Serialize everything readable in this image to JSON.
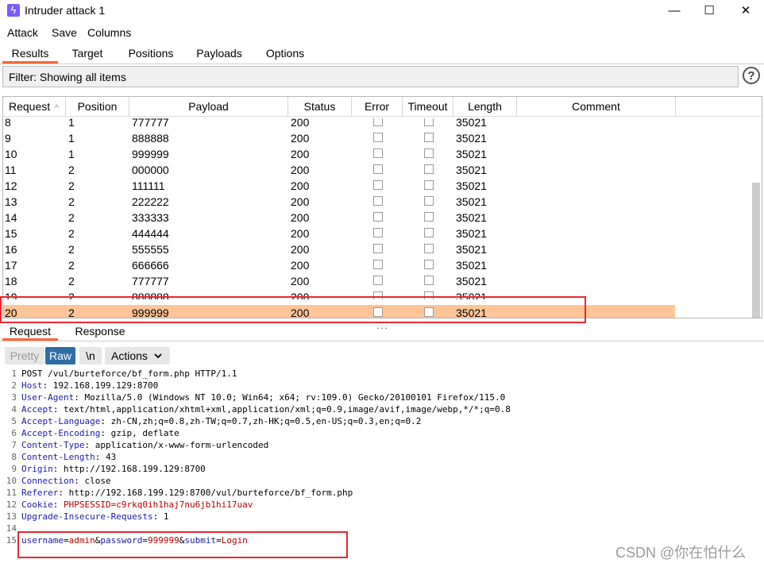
{
  "window": {
    "title": "Intruder attack 1",
    "minimize": "—",
    "maximize": "☐",
    "close": "✕"
  },
  "menu": [
    "Attack",
    "Save",
    "Columns"
  ],
  "tabs": [
    "Results",
    "Target",
    "Positions",
    "Payloads",
    "Options"
  ],
  "filter": {
    "text": "Filter: Showing all items",
    "help": "?"
  },
  "table": {
    "columns": [
      "Request",
      "Position",
      "Payload",
      "Status",
      "Error",
      "Timeout",
      "Length",
      "Comment"
    ],
    "sort_indicator": "^",
    "rows": [
      {
        "request": "8",
        "position": "1",
        "payload": "777777",
        "status": "200",
        "length": "35021"
      },
      {
        "request": "9",
        "position": "1",
        "payload": "888888",
        "status": "200",
        "length": "35021"
      },
      {
        "request": "10",
        "position": "1",
        "payload": "999999",
        "status": "200",
        "length": "35021"
      },
      {
        "request": "11",
        "position": "2",
        "payload": "000000",
        "status": "200",
        "length": "35021"
      },
      {
        "request": "12",
        "position": "2",
        "payload": "111111",
        "status": "200",
        "length": "35021"
      },
      {
        "request": "13",
        "position": "2",
        "payload": "222222",
        "status": "200",
        "length": "35021"
      },
      {
        "request": "14",
        "position": "2",
        "payload": "333333",
        "status": "200",
        "length": "35021"
      },
      {
        "request": "15",
        "position": "2",
        "payload": "444444",
        "status": "200",
        "length": "35021"
      },
      {
        "request": "16",
        "position": "2",
        "payload": "555555",
        "status": "200",
        "length": "35021"
      },
      {
        "request": "17",
        "position": "2",
        "payload": "666666",
        "status": "200",
        "length": "35021"
      },
      {
        "request": "18",
        "position": "2",
        "payload": "777777",
        "status": "200",
        "length": "35021"
      },
      {
        "request": "19",
        "position": "2",
        "payload": "888888",
        "status": "200",
        "length": "35021"
      },
      {
        "request": "20",
        "position": "2",
        "payload": "999999",
        "status": "200",
        "length": "35021"
      }
    ]
  },
  "detail_tabs": [
    "Request",
    "Response"
  ],
  "editor_toolbar": {
    "pretty": "Pretty",
    "raw": "Raw",
    "newline": "\\n",
    "actions": "Actions"
  },
  "request_lines": [
    {
      "n": "1",
      "key": "",
      "value": "POST /vul/burteforce/bf_form.php HTTP/1.1"
    },
    {
      "n": "2",
      "key": "Host",
      "value": "192.168.199.129:8700"
    },
    {
      "n": "3",
      "key": "User-Agent",
      "value": "Mozilla/5.0 (Windows NT 10.0; Win64; x64; rv:109.0) Gecko/20100101 Firefox/115.0"
    },
    {
      "n": "4",
      "key": "Accept",
      "value": "text/html,application/xhtml+xml,application/xml;q=0.9,image/avif,image/webp,*/*;q=0.8"
    },
    {
      "n": "5",
      "key": "Accept-Language",
      "value": "zh-CN,zh;q=0.8,zh-TW;q=0.7,zh-HK;q=0.5,en-US;q=0.3,en;q=0.2"
    },
    {
      "n": "6",
      "key": "Accept-Encoding",
      "value": "gzip, deflate"
    },
    {
      "n": "7",
      "key": "Content-Type",
      "value": "application/x-www-form-urlencoded"
    },
    {
      "n": "8",
      "key": "Content-Length",
      "value": "43"
    },
    {
      "n": "9",
      "key": "Origin",
      "value": "http://192.168.199.129:8700"
    },
    {
      "n": "10",
      "key": "Connection",
      "value": "close"
    },
    {
      "n": "11",
      "key": "Referer",
      "value": "http://192.168.199.129:8700/vul/burteforce/bf_form.php"
    },
    {
      "n": "12",
      "key": "Cookie",
      "value": "PHPSESSID=c9rkq0ih1haj7nu6jb1hi17uav"
    },
    {
      "n": "13",
      "key": "Upgrade-Insecure-Requests",
      "value": "1"
    },
    {
      "n": "14",
      "key": "",
      "value": ""
    }
  ],
  "body_line": {
    "n": "15",
    "params": [
      {
        "k": "username",
        "v": "admin"
      },
      {
        "k": "password",
        "v": "999999"
      },
      {
        "k": "submit",
        "v": "Login"
      }
    ]
  },
  "watermark": "CSDN @你在怕什么",
  "colors": {
    "accent": "#ff6633",
    "selected_row": "#ffc599",
    "annotation": "#e8282f",
    "raw_button": "#2f6ea5"
  }
}
